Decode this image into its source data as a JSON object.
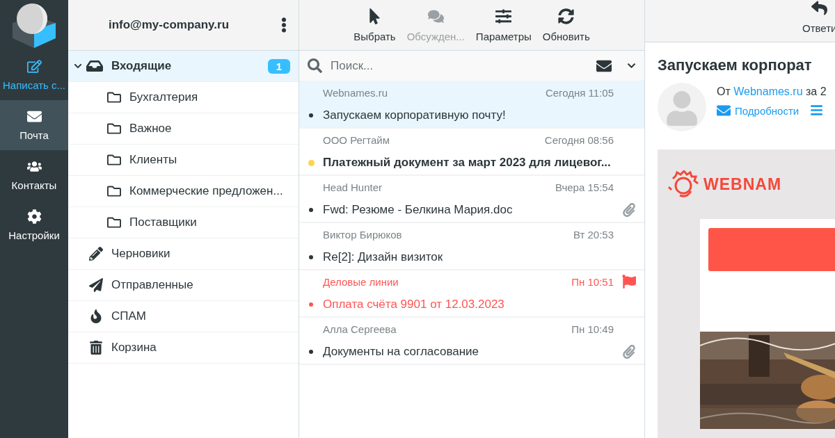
{
  "nav": [
    {
      "kind": "compose",
      "label": "Написать с...",
      "selected": false
    },
    {
      "kind": "mail",
      "label": "Почта",
      "selected": true
    },
    {
      "kind": "contacts",
      "label": "Контакты",
      "selected": false
    },
    {
      "kind": "settings",
      "label": "Настройки",
      "selected": false
    }
  ],
  "account": {
    "email": "info@my-company.ru"
  },
  "folders": [
    {
      "kind": "inbox",
      "label": "Входящие",
      "badge": "1",
      "selected": true,
      "expanded": true,
      "children": [
        {
          "kind": "folder",
          "label": "Бухгалтерия",
          "selected": false
        },
        {
          "kind": "folder",
          "label": "Важное",
          "selected": false
        },
        {
          "kind": "folder",
          "label": "Клиенты",
          "selected": false
        },
        {
          "kind": "folder",
          "label": "Коммерческие предложен...",
          "selected": false
        },
        {
          "kind": "folder",
          "label": "Поставщики",
          "selected": false
        }
      ]
    },
    {
      "kind": "drafts",
      "label": "Черновики",
      "selected": false
    },
    {
      "kind": "sent",
      "label": "Отправленные",
      "selected": false
    },
    {
      "kind": "spam",
      "label": "СПАМ",
      "selected": false
    },
    {
      "kind": "trash",
      "label": "Корзина",
      "selected": false
    }
  ],
  "toolbar": [
    {
      "kind": "select",
      "label": "Выбрать",
      "disabled": false
    },
    {
      "kind": "threads",
      "label": "Обсужден...",
      "disabled": true
    },
    {
      "kind": "options",
      "label": "Параметры",
      "disabled": false
    },
    {
      "kind": "refresh",
      "label": "Обновить",
      "disabled": false
    }
  ],
  "search": {
    "placeholder": "Поиск..."
  },
  "messages": [
    {
      "sender": "Webnames.ru",
      "date": "Сегодня 11:05",
      "subject": "Запускаем корпоративную почту!",
      "selected": true,
      "unread": false,
      "flagged": false,
      "attachment": false
    },
    {
      "sender": "ООО Регтайм",
      "date": "Сегодня 08:56",
      "subject": "Платежный документ за март 2023 для лицевог...",
      "selected": false,
      "unread": true,
      "flagged": false,
      "attachment": false
    },
    {
      "sender": "Head Hunter",
      "date": "Вчера 15:54",
      "subject": "Fwd: Резюме - Белкина Мария.doc",
      "selected": false,
      "unread": false,
      "flagged": false,
      "attachment": true
    },
    {
      "sender": "Виктор Бирюков",
      "date": "Вт 20:53",
      "subject": "Re[2]: Дизайн визиток",
      "selected": false,
      "unread": false,
      "flagged": false,
      "attachment": false
    },
    {
      "sender": "Деловые линии",
      "date": "Пн 10:51",
      "subject": "Оплата счёта 9901 от 12.03.2023",
      "selected": false,
      "unread": false,
      "flagged": true,
      "attachment": false
    },
    {
      "sender": "Алла Сергеева",
      "date": "Пн 10:49",
      "subject": "Документы на согласование",
      "selected": false,
      "unread": false,
      "flagged": false,
      "attachment": true
    }
  ],
  "reader": {
    "toolbar": [
      {
        "kind": "reply",
        "label": "Ответи"
      }
    ],
    "subject": "Запускаем корпорат",
    "from_prefix": "От",
    "from_name": "Webnames.ru",
    "from_suffix": "за 2",
    "details_link": "Подробности",
    "body": {
      "logo_text": "WEBNAM"
    }
  }
}
